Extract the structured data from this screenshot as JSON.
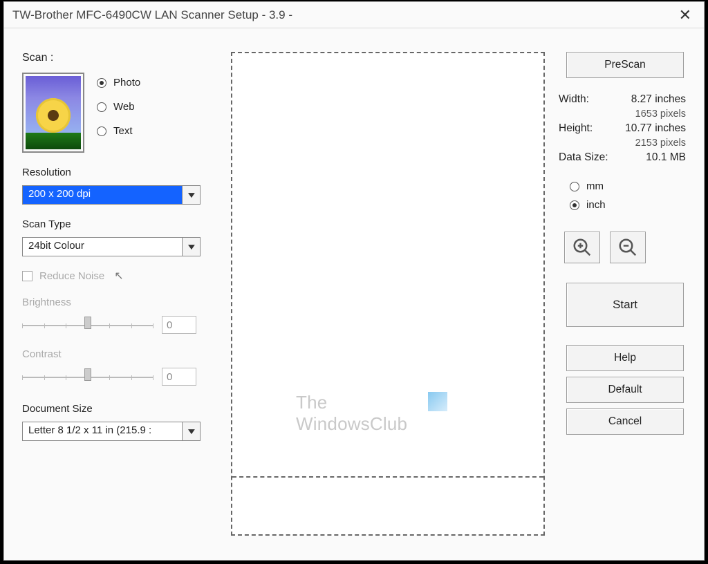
{
  "window": {
    "title": "TW-Brother MFC-6490CW LAN Scanner Setup - 3.9 -"
  },
  "left": {
    "scan_label": "Scan :",
    "modes": {
      "photo": "Photo",
      "web": "Web",
      "text": "Text"
    },
    "resolution_label": "Resolution",
    "resolution_value": "200 x 200 dpi",
    "scantype_label": "Scan Type",
    "scantype_value": "24bit Colour",
    "reduce_noise_label": "Reduce Noise",
    "brightness_label": "Brightness",
    "brightness_value": "0",
    "contrast_label": "Contrast",
    "contrast_value": "0",
    "docsize_label": "Document Size",
    "docsize_value": "Letter 8 1/2 x 11 in (215.9 :"
  },
  "watermark": {
    "line1": "The",
    "line2": "WindowsClub"
  },
  "right": {
    "prescan": "PreScan",
    "width_label": "Width:",
    "width_value": "8.27 inches",
    "width_px": "1653 pixels",
    "height_label": "Height:",
    "height_value": "10.77 inches",
    "height_px": "2153 pixels",
    "datasize_label": "Data Size:",
    "datasize_value": "10.1 MB",
    "unit_mm": "mm",
    "unit_inch": "inch",
    "start": "Start",
    "help": "Help",
    "default": "Default",
    "cancel": "Cancel"
  }
}
